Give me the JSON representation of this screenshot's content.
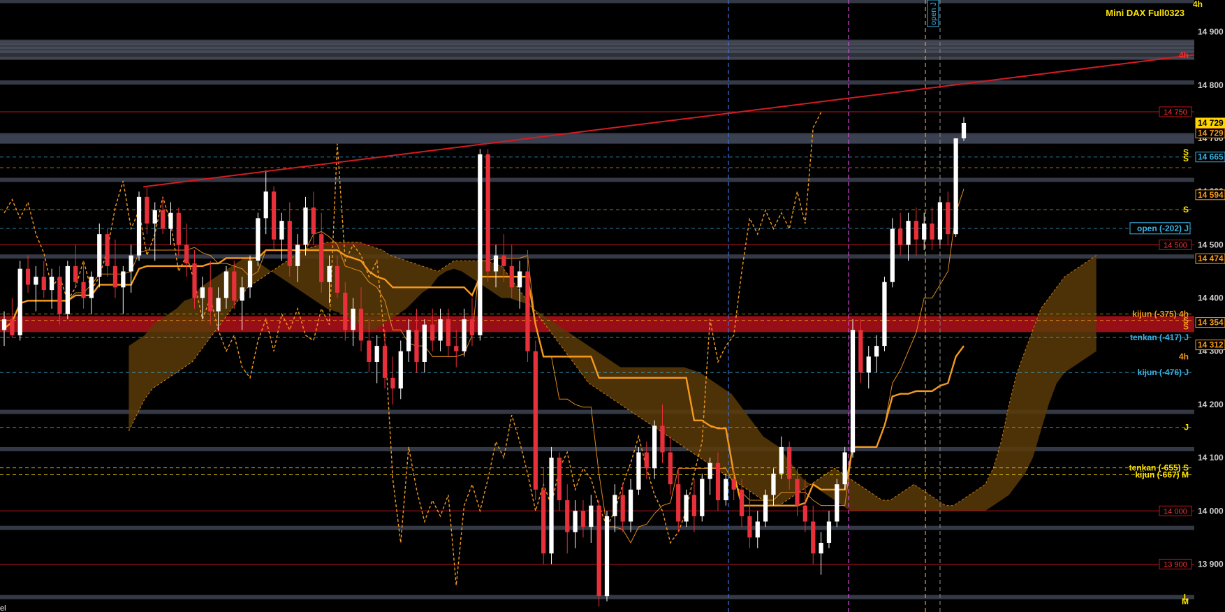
{
  "header": {
    "timeframe": "4h",
    "instrument": "Mini DAX Full0323",
    "cursor_label": "el"
  },
  "colors": {
    "background": "#000000",
    "bull_candle": "#ffffff",
    "bear_candle": "#e8303a",
    "ichimoku_line": "#f59a1e",
    "cloud_fill": "#5a3a08",
    "level_red": "#c0141c",
    "level_cyan": "#39b4e6",
    "level_yellow": "#ffe500",
    "trendline": "#d21c24",
    "band_gray": "#3a3f4d",
    "axis_text": "#d0d0d0"
  },
  "chart_data": {
    "type": "candlestick",
    "title": "Mini DAX Full0323",
    "timeframe": "4h",
    "y_axis": {
      "position": "right",
      "range": [
        13810,
        14960
      ],
      "ticks": [
        {
          "value": 14900,
          "label": "14 900"
        },
        {
          "value": 14800,
          "label": "14 800"
        },
        {
          "value": 14700,
          "label": "14 700"
        },
        {
          "value": 14600,
          "label": "14 600"
        },
        {
          "value": 14500,
          "label": "14 500"
        },
        {
          "value": 14400,
          "label": "14 400"
        },
        {
          "value": 14300,
          "label": "14 300"
        },
        {
          "value": 14200,
          "label": "14 200"
        },
        {
          "value": 14100,
          "label": "14 100"
        },
        {
          "value": 14000,
          "label": "14 000"
        },
        {
          "value": 13900,
          "label": "13 900"
        }
      ]
    },
    "price_tags": [
      {
        "label": "14 729",
        "value": 14729,
        "style": "current"
      },
      {
        "label": "14 729",
        "value": 14710,
        "style": "orange"
      },
      {
        "label": "14 665",
        "value": 14665,
        "style": "cyan"
      },
      {
        "label": "14 594",
        "value": 14594,
        "style": "orange"
      },
      {
        "label": "14 474",
        "value": 14474,
        "style": "orange"
      },
      {
        "label": "14 354",
        "value": 14354,
        "style": "orange"
      },
      {
        "label": "14 312",
        "value": 14312,
        "style": "orange"
      }
    ],
    "red_levels": [
      {
        "label": "14 750",
        "value": 14750
      },
      {
        "label": "14 500",
        "value": 14500
      },
      {
        "label": "14 000",
        "value": 14000
      },
      {
        "label": "13 900",
        "value": 13900
      }
    ],
    "level_annotations": [
      {
        "text": "4h",
        "value": 14856,
        "color": "#ff2a2a"
      },
      {
        "text": "S",
        "value": 14674,
        "color": "#ffe500"
      },
      {
        "text": "S",
        "value": 14662,
        "color": "#ffe500"
      },
      {
        "text": "S",
        "value": 14566,
        "color": "#ffe500"
      },
      {
        "text": "open (-202) J",
        "value": 14531,
        "color": "#39b4e6",
        "boxed": true
      },
      {
        "text": "kijun (-375) 4h",
        "value": 14370,
        "color": "#f59a1e"
      },
      {
        "text": "S",
        "value": 14358,
        "color": "#f59a1e"
      },
      {
        "text": "S",
        "value": 14346,
        "color": "#f59a1e"
      },
      {
        "text": "tenkan (-417) J",
        "value": 14326,
        "color": "#39b4e6"
      },
      {
        "text": "4h",
        "value": 14290,
        "color": "#f59a1e"
      },
      {
        "text": "kijun (-476) J",
        "value": 14260,
        "color": "#39b4e6"
      },
      {
        "text": "J",
        "value": 14157,
        "color": "#ffe500"
      },
      {
        "text": "tenkan (-655) S",
        "value": 14081,
        "color": "#ffe500"
      },
      {
        "text": "kijun (-667) M",
        "value": 14068,
        "color": "#ffe500"
      },
      {
        "text": "L",
        "value": 13838,
        "color": "#ffe500"
      },
      {
        "text": "M",
        "value": 13830,
        "color": "#ffe500"
      }
    ],
    "vertical_marker": {
      "text": "open J"
    },
    "gray_bands": [
      14958,
      14883,
      14877,
      14870,
      14863,
      14850,
      14805,
      14703,
      14695,
      14622,
      14478,
      14186,
      14116,
      13968,
      13838
    ],
    "trendline": {
      "from": [
        0.12,
        14609
      ],
      "to": [
        1.0,
        14857
      ]
    },
    "candles": [
      [
        14340,
        14375,
        14310,
        14360
      ],
      [
        14360,
        14400,
        14325,
        14330
      ],
      [
        14330,
        14470,
        14320,
        14455
      ],
      [
        14455,
        14480,
        14410,
        14425
      ],
      [
        14425,
        14460,
        14375,
        14440
      ],
      [
        14440,
        14470,
        14400,
        14415
      ],
      [
        14415,
        14455,
        14380,
        14440
      ],
      [
        14440,
        14460,
        14350,
        14370
      ],
      [
        14370,
        14470,
        14360,
        14460
      ],
      [
        14460,
        14500,
        14420,
        14430
      ],
      [
        14430,
        14470,
        14380,
        14400
      ],
      [
        14400,
        14450,
        14370,
        14440
      ],
      [
        14440,
        14540,
        14420,
        14520
      ],
      [
        14520,
        14530,
        14440,
        14460
      ],
      [
        14460,
        14510,
        14400,
        14420
      ],
      [
        14420,
        14460,
        14370,
        14450
      ],
      [
        14450,
        14500,
        14410,
        14480
      ],
      [
        14480,
        14600,
        14470,
        14590
      ],
      [
        14590,
        14610,
        14520,
        14540
      ],
      [
        14540,
        14580,
        14470,
        14565
      ],
      [
        14565,
        14590,
        14520,
        14530
      ],
      [
        14530,
        14580,
        14500,
        14560
      ],
      [
        14560,
        14570,
        14480,
        14500
      ],
      [
        14500,
        14540,
        14440,
        14465
      ],
      [
        14465,
        14490,
        14380,
        14400
      ],
      [
        14400,
        14440,
        14360,
        14420
      ],
      [
        14420,
        14470,
        14350,
        14375
      ],
      [
        14375,
        14420,
        14340,
        14400
      ],
      [
        14400,
        14460,
        14380,
        14450
      ],
      [
        14450,
        14470,
        14380,
        14395
      ],
      [
        14395,
        14440,
        14340,
        14420
      ],
      [
        14420,
        14480,
        14400,
        14470
      ],
      [
        14470,
        14560,
        14460,
        14550
      ],
      [
        14550,
        14640,
        14520,
        14600
      ],
      [
        14600,
        14610,
        14490,
        14510
      ],
      [
        14510,
        14560,
        14470,
        14545
      ],
      [
        14545,
        14580,
        14440,
        14460
      ],
      [
        14460,
        14520,
        14430,
        14500
      ],
      [
        14500,
        14590,
        14480,
        14570
      ],
      [
        14570,
        14600,
        14500,
        14520
      ],
      [
        14520,
        14560,
        14410,
        14430
      ],
      [
        14430,
        14480,
        14390,
        14460
      ],
      [
        14460,
        14480,
        14400,
        14410
      ],
      [
        14410,
        14430,
        14320,
        14340
      ],
      [
        14340,
        14400,
        14310,
        14380
      ],
      [
        14380,
        14420,
        14300,
        14320
      ],
      [
        14320,
        14360,
        14260,
        14280
      ],
      [
        14280,
        14330,
        14240,
        14310
      ],
      [
        14310,
        14340,
        14230,
        14250
      ],
      [
        14250,
        14290,
        14200,
        14230
      ],
      [
        14230,
        14320,
        14210,
        14300
      ],
      [
        14300,
        14360,
        14280,
        14340
      ],
      [
        14340,
        14380,
        14260,
        14280
      ],
      [
        14280,
        14360,
        14260,
        14350
      ],
      [
        14350,
        14380,
        14300,
        14320
      ],
      [
        14320,
        14380,
        14300,
        14360
      ],
      [
        14360,
        14380,
        14290,
        14310
      ],
      [
        14310,
        14340,
        14270,
        14300
      ],
      [
        14300,
        14380,
        14290,
        14360
      ],
      [
        14360,
        14400,
        14310,
        14330
      ],
      [
        14330,
        14680,
        14320,
        14670
      ],
      [
        14670,
        14680,
        14430,
        14450
      ],
      [
        14450,
        14500,
        14420,
        14480
      ],
      [
        14480,
        14520,
        14430,
        14460
      ],
      [
        14460,
        14500,
        14400,
        14420
      ],
      [
        14420,
        14470,
        14380,
        14450
      ],
      [
        14450,
        14490,
        14280,
        14300
      ],
      [
        14300,
        14320,
        14020,
        14040
      ],
      [
        14040,
        14080,
        13900,
        13920
      ],
      [
        13920,
        14120,
        13900,
        14100
      ],
      [
        14100,
        14110,
        14000,
        14020
      ],
      [
        14020,
        14050,
        13920,
        13960
      ],
      [
        13960,
        14020,
        13930,
        14000
      ],
      [
        14000,
        14020,
        13950,
        13970
      ],
      [
        13970,
        14030,
        13940,
        14010
      ],
      [
        14010,
        14020,
        13820,
        13840
      ],
      [
        13840,
        14000,
        13830,
        13990
      ],
      [
        13990,
        14050,
        13960,
        14030
      ],
      [
        14030,
        14050,
        13960,
        13980
      ],
      [
        13980,
        14060,
        13960,
        14040
      ],
      [
        14040,
        14120,
        14030,
        14110
      ],
      [
        14110,
        14130,
        14060,
        14080
      ],
      [
        14080,
        14170,
        14060,
        14160
      ],
      [
        14160,
        14200,
        14090,
        14110
      ],
      [
        14110,
        14140,
        14030,
        14050
      ],
      [
        14050,
        14080,
        13960,
        13980
      ],
      [
        13980,
        14040,
        13970,
        14030
      ],
      [
        14030,
        14060,
        13960,
        13990
      ],
      [
        13990,
        14070,
        13980,
        14060
      ],
      [
        14060,
        14100,
        14030,
        14090
      ],
      [
        14090,
        14110,
        14000,
        14020
      ],
      [
        14020,
        14070,
        14010,
        14060
      ],
      [
        14060,
        14080,
        14020,
        14040
      ],
      [
        14040,
        14060,
        13970,
        13990
      ],
      [
        13990,
        14040,
        13930,
        13950
      ],
      [
        13950,
        14000,
        13930,
        13980
      ],
      [
        13980,
        14040,
        13970,
        14030
      ],
      [
        14030,
        14080,
        14010,
        14070
      ],
      [
        14070,
        14140,
        14060,
        14120
      ],
      [
        14120,
        14130,
        14040,
        14060
      ],
      [
        14060,
        14080,
        13990,
        14010
      ],
      [
        14010,
        14060,
        13960,
        13980
      ],
      [
        13980,
        14010,
        13900,
        13920
      ],
      [
        13920,
        13960,
        13880,
        13940
      ],
      [
        13940,
        14000,
        13930,
        13980
      ],
      [
        13980,
        14060,
        13970,
        14050
      ],
      [
        14050,
        14120,
        14040,
        14110
      ],
      [
        14110,
        14360,
        14100,
        14340
      ],
      [
        14340,
        14360,
        14240,
        14260
      ],
      [
        14260,
        14310,
        14230,
        14290
      ],
      [
        14290,
        14330,
        14260,
        14310
      ],
      [
        14310,
        14440,
        14300,
        14430
      ],
      [
        14430,
        14550,
        14420,
        14530
      ],
      [
        14530,
        14560,
        14480,
        14500
      ],
      [
        14500,
        14560,
        14470,
        14545
      ],
      [
        14545,
        14570,
        14480,
        14510
      ],
      [
        14510,
        14560,
        14490,
        14540
      ],
      [
        14540,
        14570,
        14490,
        14510
      ],
      [
        14510,
        14590,
        14500,
        14580
      ],
      [
        14580,
        14600,
        14500,
        14520
      ],
      [
        14520,
        14700,
        14515,
        14700
      ],
      [
        14700,
        14740,
        14695,
        14729
      ]
    ],
    "cloud_lower": [
      14310,
      14320,
      14330,
      14350,
      14360,
      14370,
      14380,
      14395,
      14400,
      14420,
      14430,
      14440,
      14450,
      14460,
      14470,
      14480,
      14470,
      14460,
      14450,
      14440,
      14430,
      14420,
      14410,
      14400,
      14390,
      14380,
      14375,
      14370,
      14360,
      14350,
      14340,
      14340,
      14350,
      14360,
      14370,
      14380,
      14395,
      14410,
      14420,
      14440,
      14450,
      14455,
      14450,
      14440,
      14430,
      14420,
      14410,
      14400,
      14400,
      14395,
      14390,
      14380,
      14370,
      14360,
      14350,
      14340,
      14330,
      14320,
      14310,
      14300,
      14290,
      14280,
      14270,
      14270,
      14270,
      14270,
      14270,
      14270,
      14270,
      14270,
      14270,
      14265,
      14260,
      14250,
      14240,
      14230,
      14220,
      14200,
      14180,
      14160,
      14140,
      14130,
      14120,
      14100,
      14080,
      14060,
      14050,
      14040,
      14030,
      14020,
      14010,
      14000,
      14000,
      14000,
      14000,
      14000,
      14000,
      14000,
      14000,
      14000,
      14000,
      14000,
      14000,
      14000,
      14000,
      14000,
      14000,
      14000,
      14000,
      14010,
      14020,
      14030,
      14050,
      14070,
      14100,
      14150,
      14200,
      14240,
      14260,
      14270,
      14280,
      14290,
      14300
    ],
    "cloud_upper": [
      14150,
      14180,
      14210,
      14230,
      14240,
      14250,
      14260,
      14270,
      14280,
      14300,
      14320,
      14340,
      14360,
      14380,
      14400,
      14420,
      14430,
      14440,
      14450,
      14460,
      14470,
      14480,
      14490,
      14495,
      14500,
      14505,
      14505,
      14505,
      14505,
      14505,
      14500,
      14495,
      14490,
      14480,
      14475,
      14470,
      14465,
      14460,
      14455,
      14450,
      14460,
      14470,
      14470,
      14470,
      14470,
      14470,
      14465,
      14460,
      14440,
      14420,
      14400,
      14380,
      14360,
      14340,
      14320,
      14300,
      14280,
      14260,
      14240,
      14230,
      14220,
      14210,
      14200,
      14190,
      14180,
      14170,
      14160,
      14150,
      14140,
      14130,
      14120,
      14110,
      14100,
      14090,
      14080,
      14070,
      14060,
      14050,
      14040,
      14030,
      14020,
      14010,
      14010,
      14020,
      14030,
      14040,
      14050,
      14060,
      14070,
      14080,
      14070,
      14060,
      14050,
      14040,
      14030,
      14020,
      14020,
      14030,
      14040,
      14050,
      14040,
      14030,
      14020,
      14010,
      14010,
      14020,
      14030,
      14040,
      14050,
      14080,
      14130,
      14200,
      14260,
      14300,
      14340,
      14380,
      14400,
      14420,
      14440,
      14450,
      14460,
      14470,
      14480
    ]
  }
}
